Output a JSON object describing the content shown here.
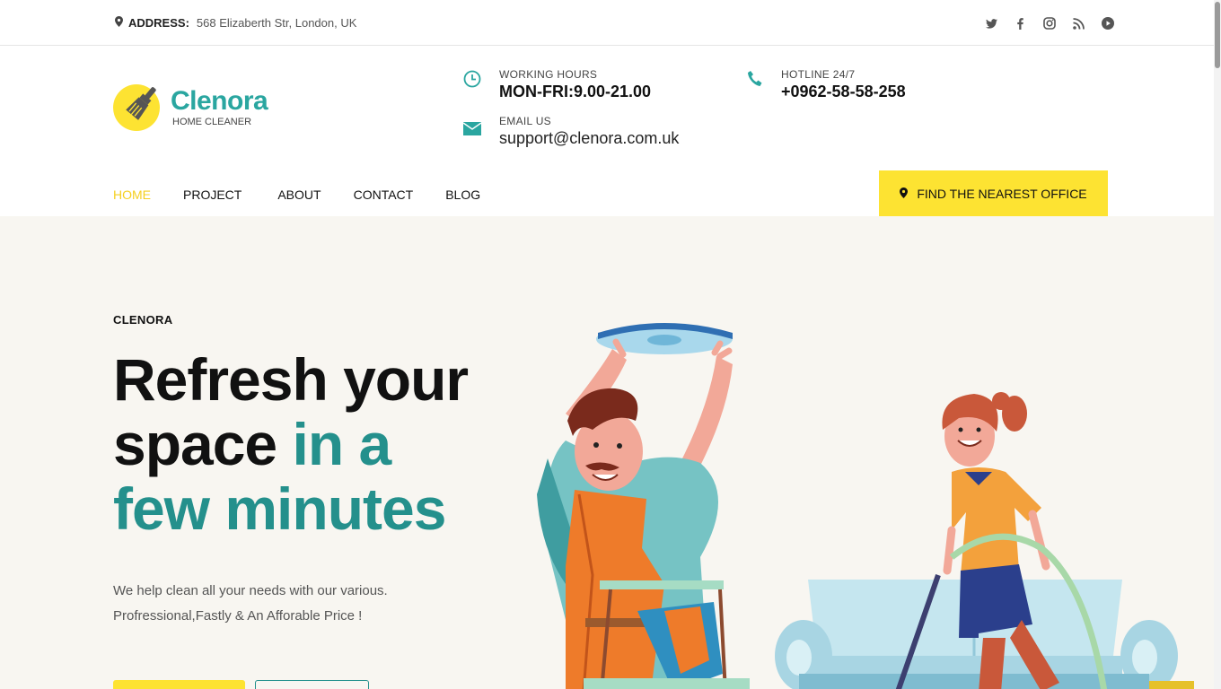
{
  "topbar": {
    "address_label": "ADDRESS:",
    "address_value": "568 Elizaberth Str, London, UK",
    "socials": [
      "twitter-icon",
      "facebook-icon",
      "instagram-icon",
      "rss-icon",
      "youtube-icon"
    ]
  },
  "header": {
    "brand": "Clenora",
    "tagline": "HOME CLEANER",
    "working_hours_label": "WORKING HOURS",
    "working_hours_value": "MON-FRI:9.00-21.00",
    "hotline_label": "HOTLINE 24/7",
    "hotline_value": "+0962-58-58-258",
    "email_label": "EMAIL US",
    "email_value": "support@clenora.com.uk"
  },
  "nav": {
    "items": [
      {
        "label": "HOME",
        "active": true
      },
      {
        "label": "PROJECT",
        "active": false
      },
      {
        "label": "ABOUT",
        "active": false
      },
      {
        "label": "CONTACT",
        "active": false
      },
      {
        "label": "BLOG",
        "active": false
      }
    ],
    "cta_label": "FIND THE NEAREST OFFICE"
  },
  "hero": {
    "eyebrow": "CLENORA",
    "headline_1": "Refresh your",
    "headline_2a": "space ",
    "headline_2b": "in a",
    "headline_3": "few minutes",
    "sub_1": "We help clean all your needs with our various.",
    "sub_2": "Profressional,Fastly & An Afforable Price !"
  },
  "colors": {
    "accent_yellow": "#fde332",
    "teal": "#24908c",
    "hero_bg": "#f8f6f1"
  }
}
